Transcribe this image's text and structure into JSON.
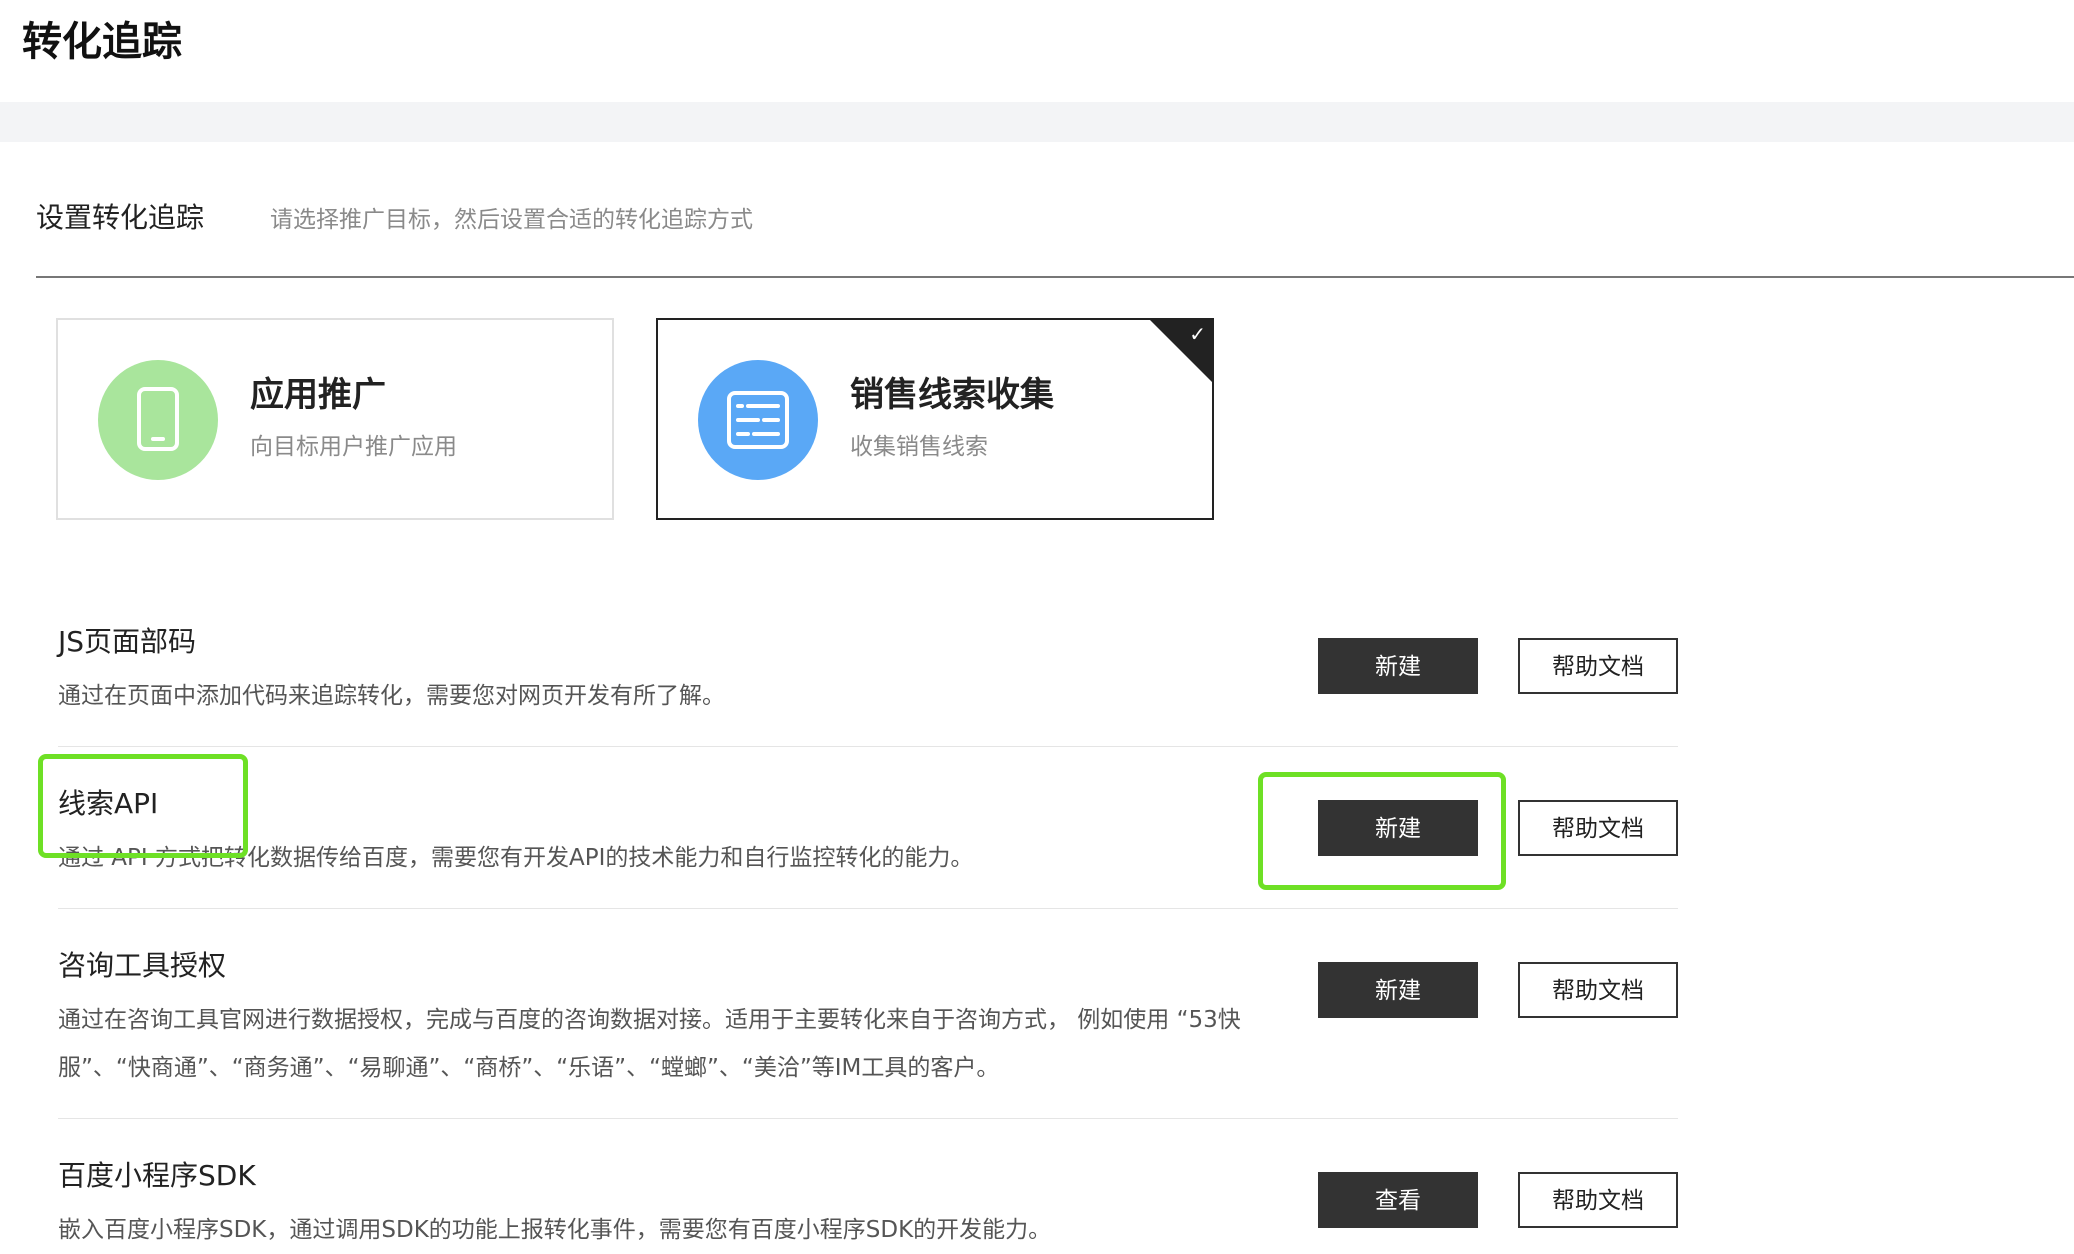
{
  "page": {
    "title": "转化追踪"
  },
  "setup": {
    "title": "设置转化追踪",
    "hint": "请选择推广目标，然后设置合适的转化追踪方式"
  },
  "goals": [
    {
      "name": "应用推广",
      "desc": "向目标用户推广应用",
      "icon": "mobile-phone-icon",
      "color": "#a9e59c",
      "selected": false
    },
    {
      "name": "销售线索收集",
      "desc": "收集销售线索",
      "icon": "form-list-icon",
      "color": "#5aa8f6",
      "selected": true
    }
  ],
  "methods": [
    {
      "name": "JS页面部码",
      "desc": "通过在页面中添加代码来追踪转化，需要您对网页开发有所了解。",
      "action": "新建",
      "help": "帮助文档"
    },
    {
      "name": "线索API",
      "desc": "通过 API 方式把转化数据传给百度，需要您有开发API的技术能力和自行监控转化的能力。",
      "action": "新建",
      "help": "帮助文档"
    },
    {
      "name": "咨询工具授权",
      "desc": "通过在咨询工具官网进行数据授权，完成与百度的咨询数据对接。适用于主要转化来自于咨询方式， 例如使用 “53快服”、“快商通”、“商务通”、“易聊通”、“商桥”、“乐语”、“螳螂”、“美洽”等IM工具的客户。",
      "action": "新建",
      "help": "帮助文档"
    },
    {
      "name": "百度小程序SDK",
      "desc": "嵌入百度小程序SDK，通过调用SDK的功能上报转化事件，需要您有百度小程序SDK的开发能力。",
      "action": "查看",
      "help": "帮助文档"
    }
  ],
  "colors": {
    "highlight": "#6ee025",
    "dark_button": "#333333"
  }
}
